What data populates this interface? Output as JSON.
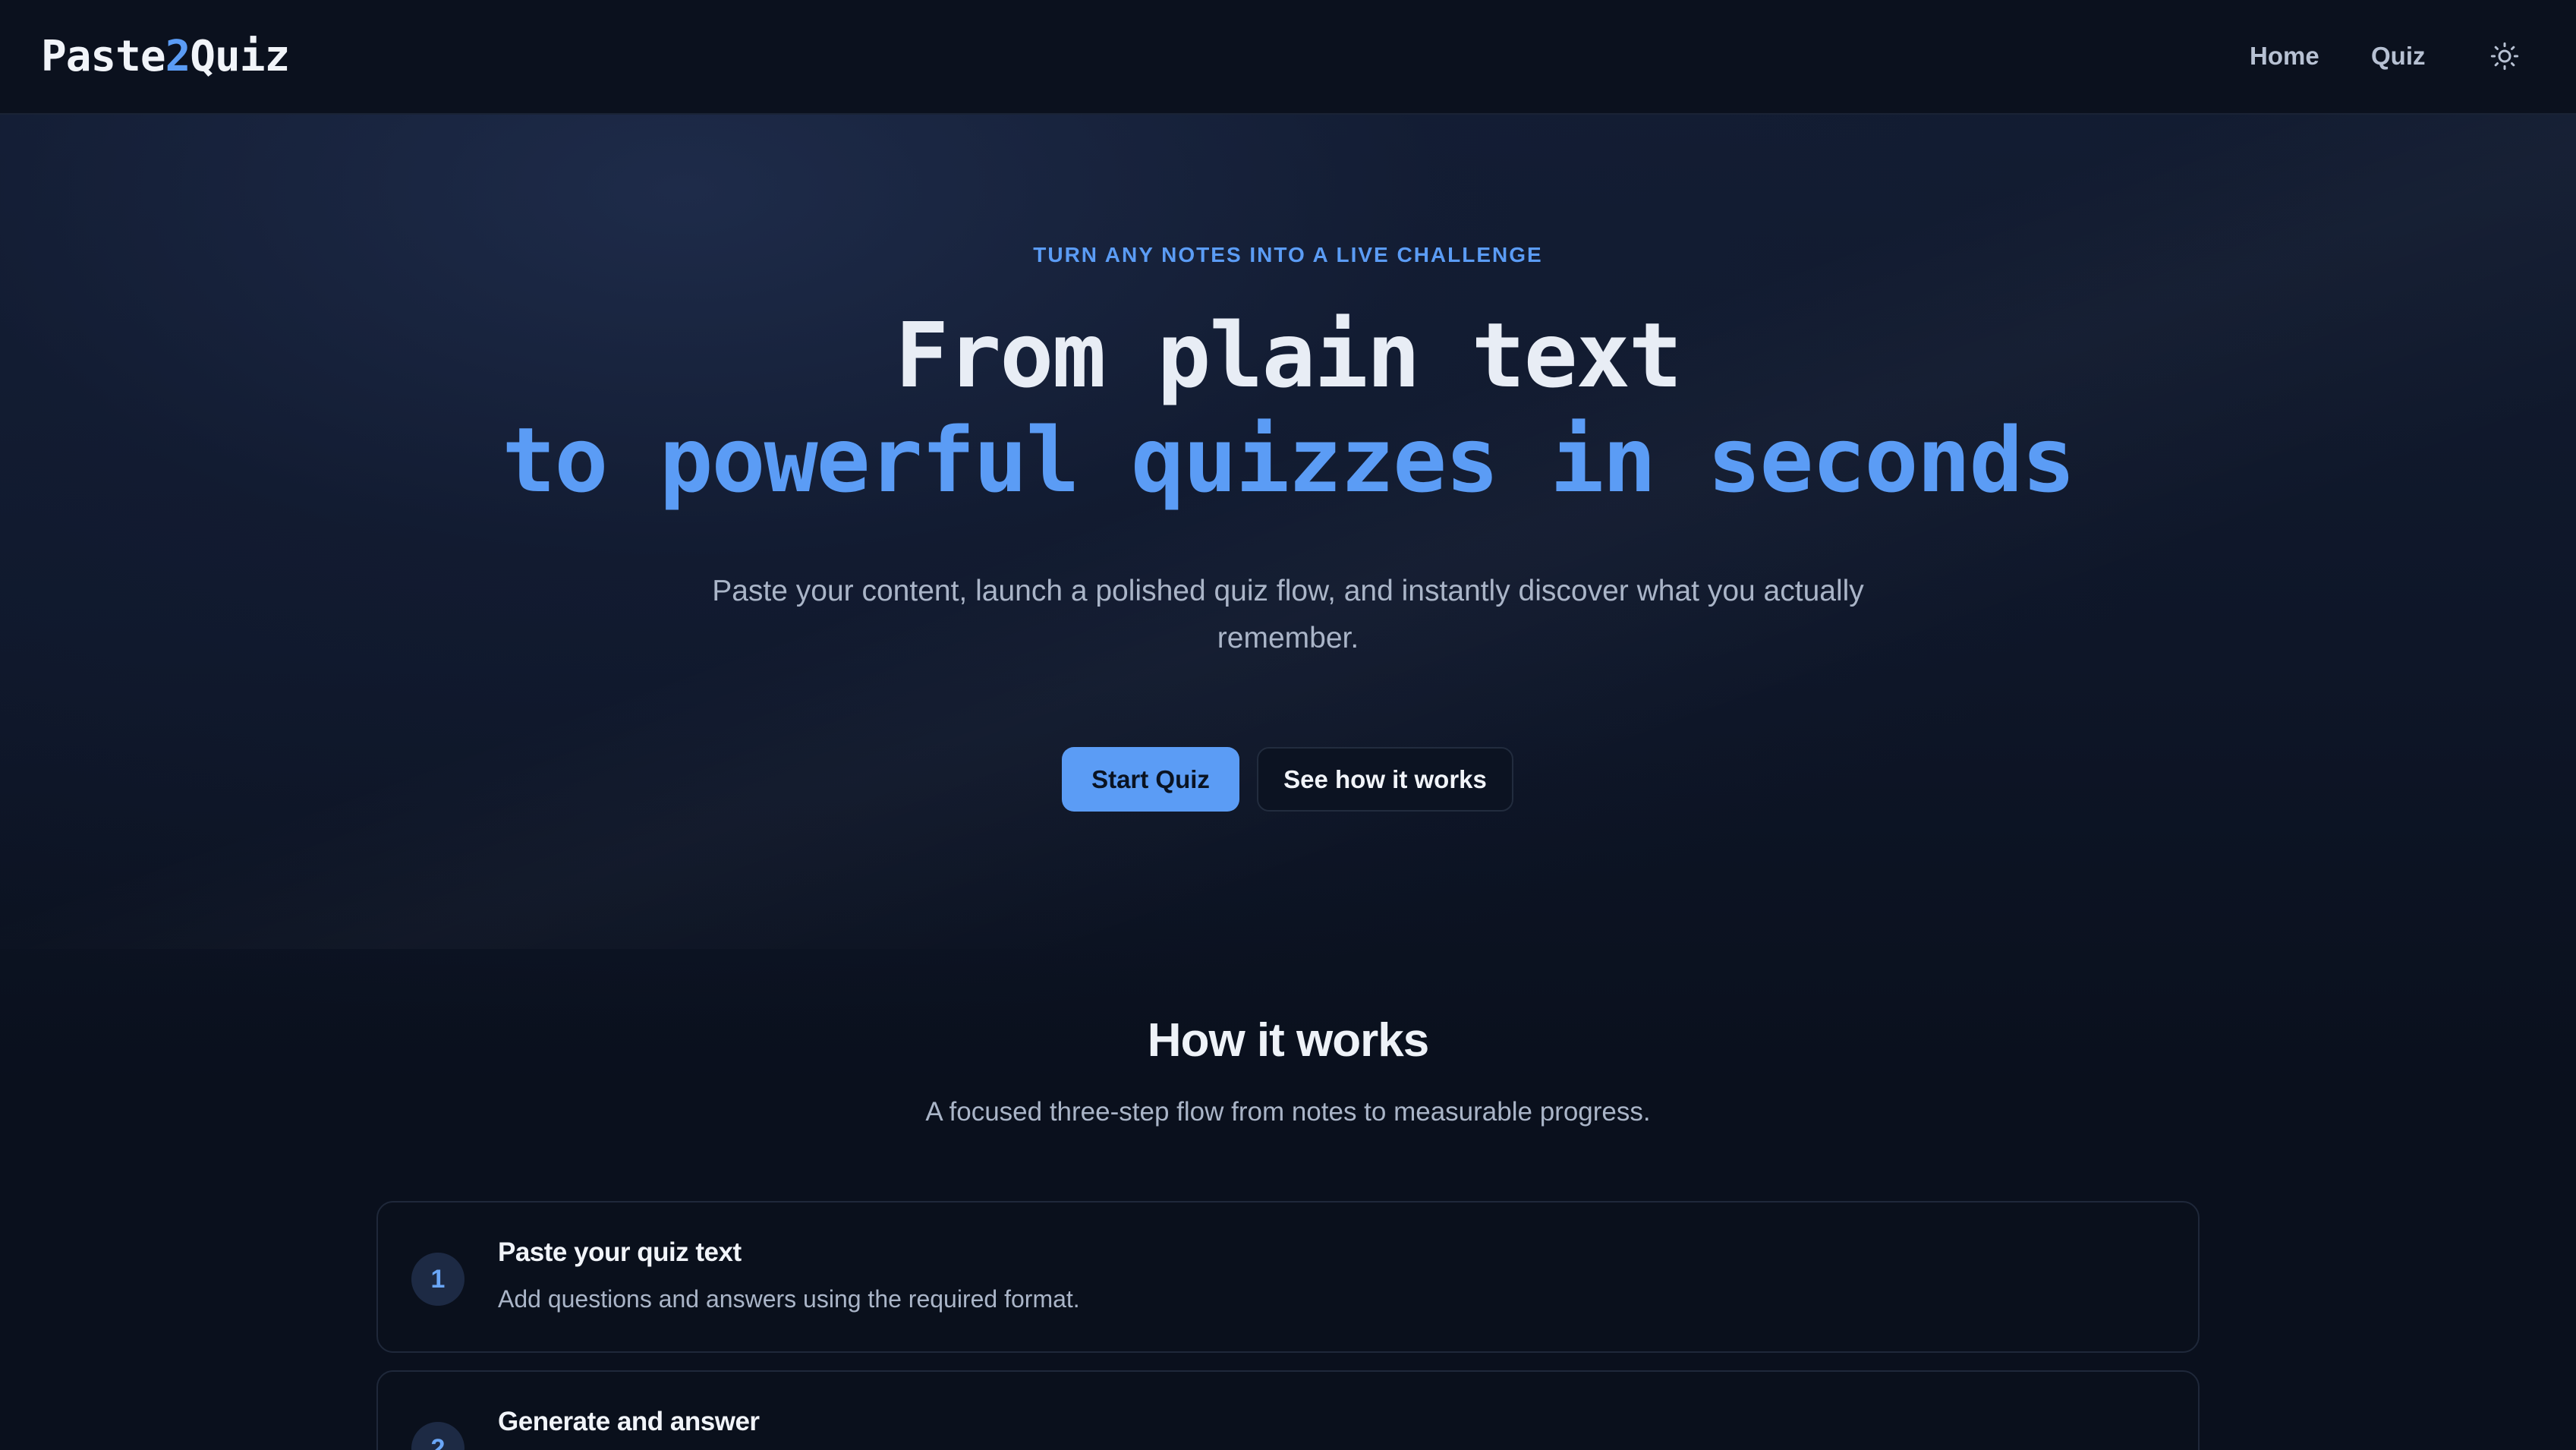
{
  "header": {
    "logo_part1": "Paste",
    "logo_accent": "2",
    "logo_part2": "Quiz",
    "nav": {
      "home": "Home",
      "quiz": "Quiz"
    },
    "theme_toggle_icon": "sun-icon"
  },
  "hero": {
    "eyebrow": "TURN ANY NOTES INTO A LIVE CHALLENGE",
    "title_line1": "From plain text",
    "title_line2": "to powerful quizzes in seconds",
    "subtitle": "Paste your content, launch a polished quiz flow, and instantly discover what you actually remember.",
    "primary_button": "Start Quiz",
    "secondary_button": "See how it works"
  },
  "how_it_works": {
    "title": "How it works",
    "subtitle": "A focused three-step flow from notes to measurable progress.",
    "steps": [
      {
        "number": "1",
        "title": "Paste your quiz text",
        "description": "Add questions and answers using the required format."
      },
      {
        "number": "2",
        "title": "Generate and answer",
        "description": ""
      }
    ]
  },
  "colors": {
    "accent": "#5b9cf5",
    "background": "#0a101d",
    "header_bg": "#0b111e",
    "text_primary": "#e8edf5",
    "text_muted": "#aab5c8"
  }
}
